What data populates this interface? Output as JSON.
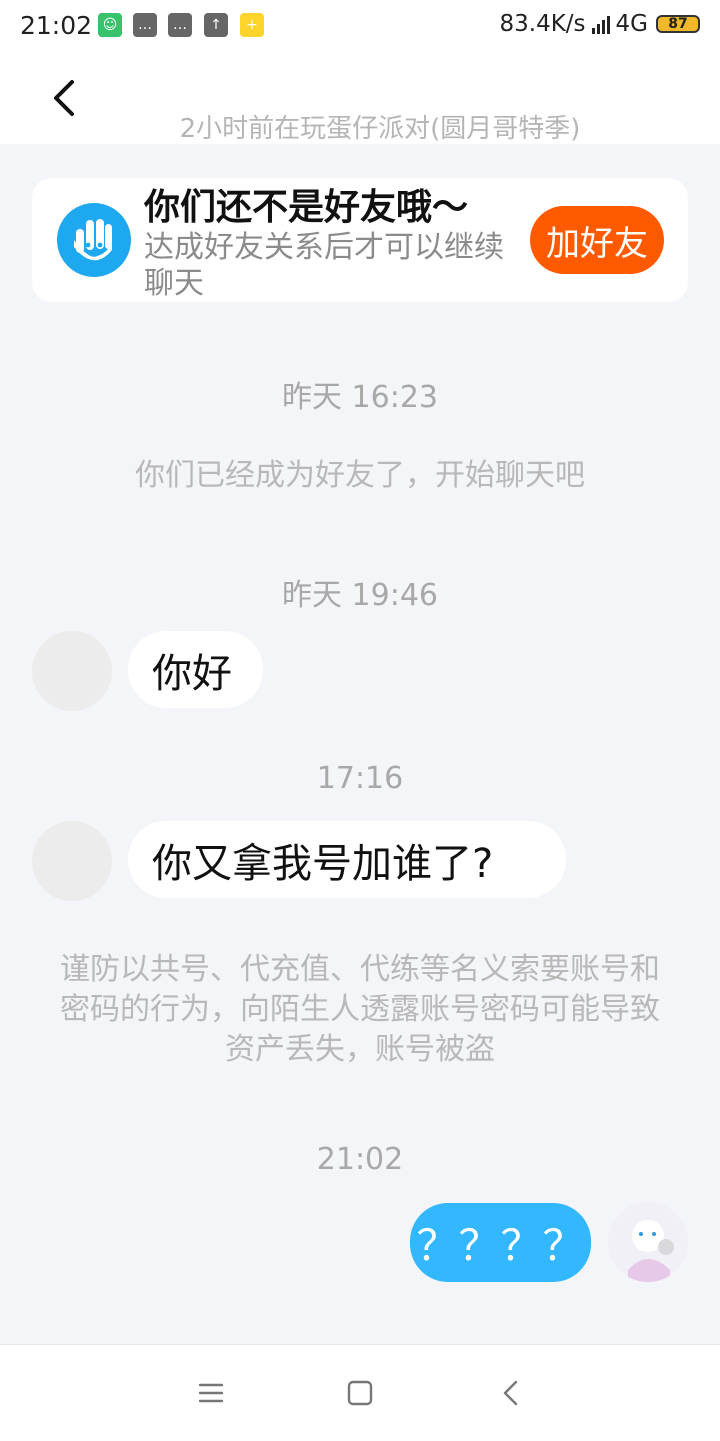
{
  "status_bar": {
    "time": "21:02",
    "net_speed": "83.4K/s",
    "network": "4G",
    "battery": "87",
    "icons": [
      "cat-app-icon",
      "message-icon",
      "message-icon",
      "upload-icon",
      "notification-icon"
    ]
  },
  "header": {
    "subtitle": "2小时前在玩蛋仔派对(圆月哥特季)"
  },
  "friend_card": {
    "title": "你们还不是好友哦～",
    "description": "达成好友关系后才可以继续聊天",
    "button": "加好友"
  },
  "messages": [
    {
      "type": "time",
      "text": "昨天 16:23"
    },
    {
      "type": "system",
      "text": "你们已经成为好友了，开始聊天吧"
    },
    {
      "type": "time",
      "text": "昨天 19:46"
    },
    {
      "type": "received",
      "text": "你好"
    },
    {
      "type": "time",
      "text": "17:16"
    },
    {
      "type": "received",
      "text": "你又拿我号加谁了?"
    },
    {
      "type": "system",
      "text": "谨防以共号、代充值、代练等名义索要账号和密码的行为，向陌生人透露账号密码可能导致资产丢失，账号被盗"
    },
    {
      "type": "time",
      "text": "21:02"
    },
    {
      "type": "sent",
      "text": "？？？？"
    }
  ],
  "colors": {
    "accent": "#33b8ff",
    "add_button": "#ff5a00",
    "background": "#f3f5f8"
  }
}
